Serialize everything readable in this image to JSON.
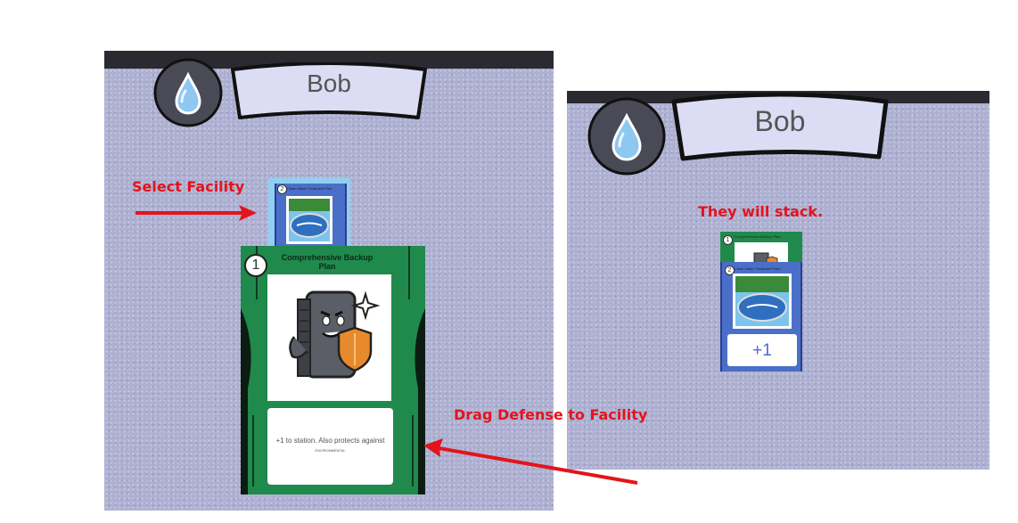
{
  "left_panel": {
    "player_name": "Bob",
    "select_label": "Select Facility",
    "drag_label": "Drag Defense to Facility",
    "facility_card": {
      "badge": "2",
      "title": "Clean Water Treatment Plant"
    },
    "defense_card": {
      "badge": "1",
      "title": "Comprehensive Backup Plan",
      "description": "+1 to station. Also protects against",
      "subtext": "ENVIRONMENTAL"
    }
  },
  "right_panel": {
    "player_name": "Bob",
    "stack_label": "They will stack.",
    "stack": {
      "top_badge": "1",
      "top_title": "Comprehensive Backup Plan",
      "bottom_badge": "2",
      "bottom_title": "Clean Water Treatment Plant",
      "bonus": "+1"
    }
  },
  "colors": {
    "annotation_red": "#e3141b",
    "defense_green": "#1f8a4c",
    "facility_blue": "#4a6fc9",
    "panel_lavender": "#aeb0d2",
    "banner_fill": "#dcdcf4"
  },
  "icons": [
    "water-drop-icon",
    "server-mascot-icon",
    "water-treatment-icon",
    "shield-icon"
  ]
}
